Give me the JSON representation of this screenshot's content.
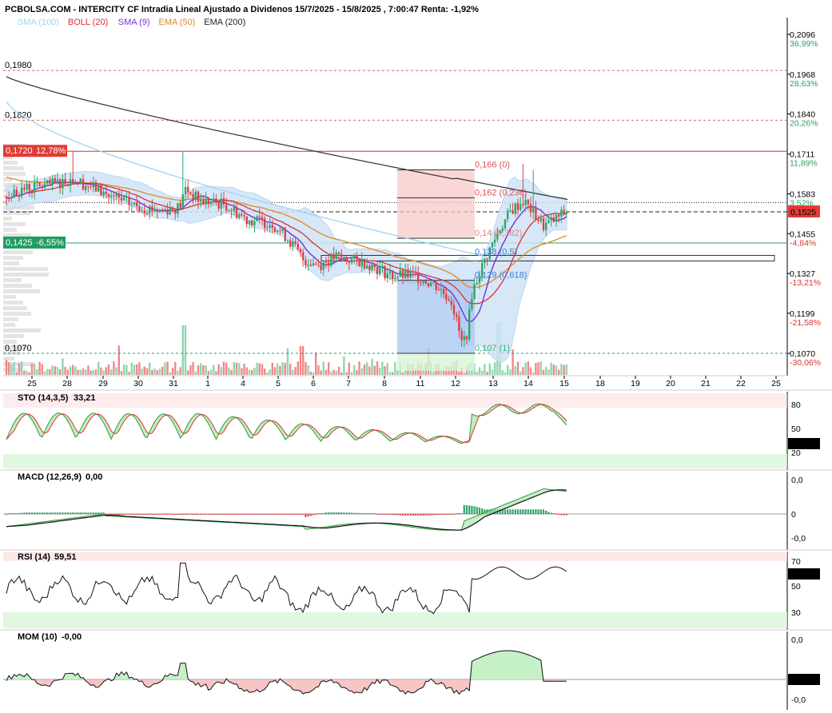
{
  "header": {
    "title": "PCBOLSA.COM - INTERCITY CF Intradia Lineal Ajustado a Dividenos 15/7/2025 - 15/8/2025 , 7:00:47 Renta: -1,92%",
    "legend": [
      {
        "label": "SMA (100)",
        "color": "#9fd4f0"
      },
      {
        "label": "BOLL (20)",
        "color": "#e03030"
      },
      {
        "label": "SMA (9)",
        "color": "#7b2fd6"
      },
      {
        "label": "EMA (50)",
        "color": "#e08a20"
      },
      {
        "label": "EMA (200)",
        "color": "#222222"
      }
    ]
  },
  "chart_data": [
    {
      "type": "candlestick",
      "panel": "price",
      "x_labels": [
        "25",
        "28",
        "29",
        "30",
        "31",
        "1",
        "4",
        "5",
        "6",
        "7",
        "8",
        "11",
        "12",
        "13",
        "14",
        "15",
        "18",
        "19",
        "20",
        "21",
        "22",
        "25"
      ],
      "price_axis": [
        {
          "value": 0.2096,
          "label": "0,2096",
          "pct": "36,99%"
        },
        {
          "value": 0.1968,
          "label": "0,1968",
          "pct": "28,63%"
        },
        {
          "value": 0.184,
          "label": "0,1840",
          "pct": "20,26%"
        },
        {
          "value": 0.1711,
          "label": "0,1711",
          "pct": "11,89%"
        },
        {
          "value": 0.1583,
          "label": "0,1583",
          "pct": "3,52%"
        },
        {
          "value": 0.1455,
          "label": "0,1455",
          "pct": "-4,84%"
        },
        {
          "value": 0.1327,
          "label": "0,1327",
          "pct": "-13,21%"
        },
        {
          "value": 0.1199,
          "label": "0,1199",
          "pct": "-21,58%"
        },
        {
          "value": 0.107,
          "label": "0,1070",
          "pct": "-30,06%"
        }
      ],
      "last_price": {
        "value": 0.1525,
        "label": "0,1525"
      },
      "levels": [
        {
          "value": 0.198,
          "label": "0,1980"
        },
        {
          "value": 0.182,
          "label": "0,1820"
        },
        {
          "value": 0.172,
          "label": "0,1720",
          "pct": "12,78%"
        },
        {
          "value": 0.1425,
          "label": "0,1425",
          "pct": "-6,55%"
        },
        {
          "value": 0.107,
          "label": "0,1070"
        }
      ],
      "fib_labels": [
        "0,166 (0)",
        "0,162 (0,236)",
        "0,14 (0,382)",
        "0,138 (0,5)",
        "0,129 (0,618)",
        "0,107 (1)"
      ],
      "ylim": [
        0.1035,
        0.213
      ]
    }
  ],
  "indicators": {
    "sto": {
      "title": "STO (14,3,5)",
      "value": "33,21",
      "last": "33,218",
      "levels": [
        "80",
        "50",
        "20"
      ]
    },
    "macd": {
      "title": "MACD (12,26,9)",
      "value": "0,00",
      "levels": [
        "0,0",
        "0",
        "-0,0"
      ]
    },
    "rsi": {
      "title": "RSI (14)",
      "value": "59,51",
      "last": "59,519",
      "levels": [
        "70",
        "50",
        "30"
      ]
    },
    "mom": {
      "title": "MOM (10)",
      "value": "-0,00",
      "last": "-0,000",
      "levels": [
        "0,0",
        "-0,0"
      ]
    }
  }
}
